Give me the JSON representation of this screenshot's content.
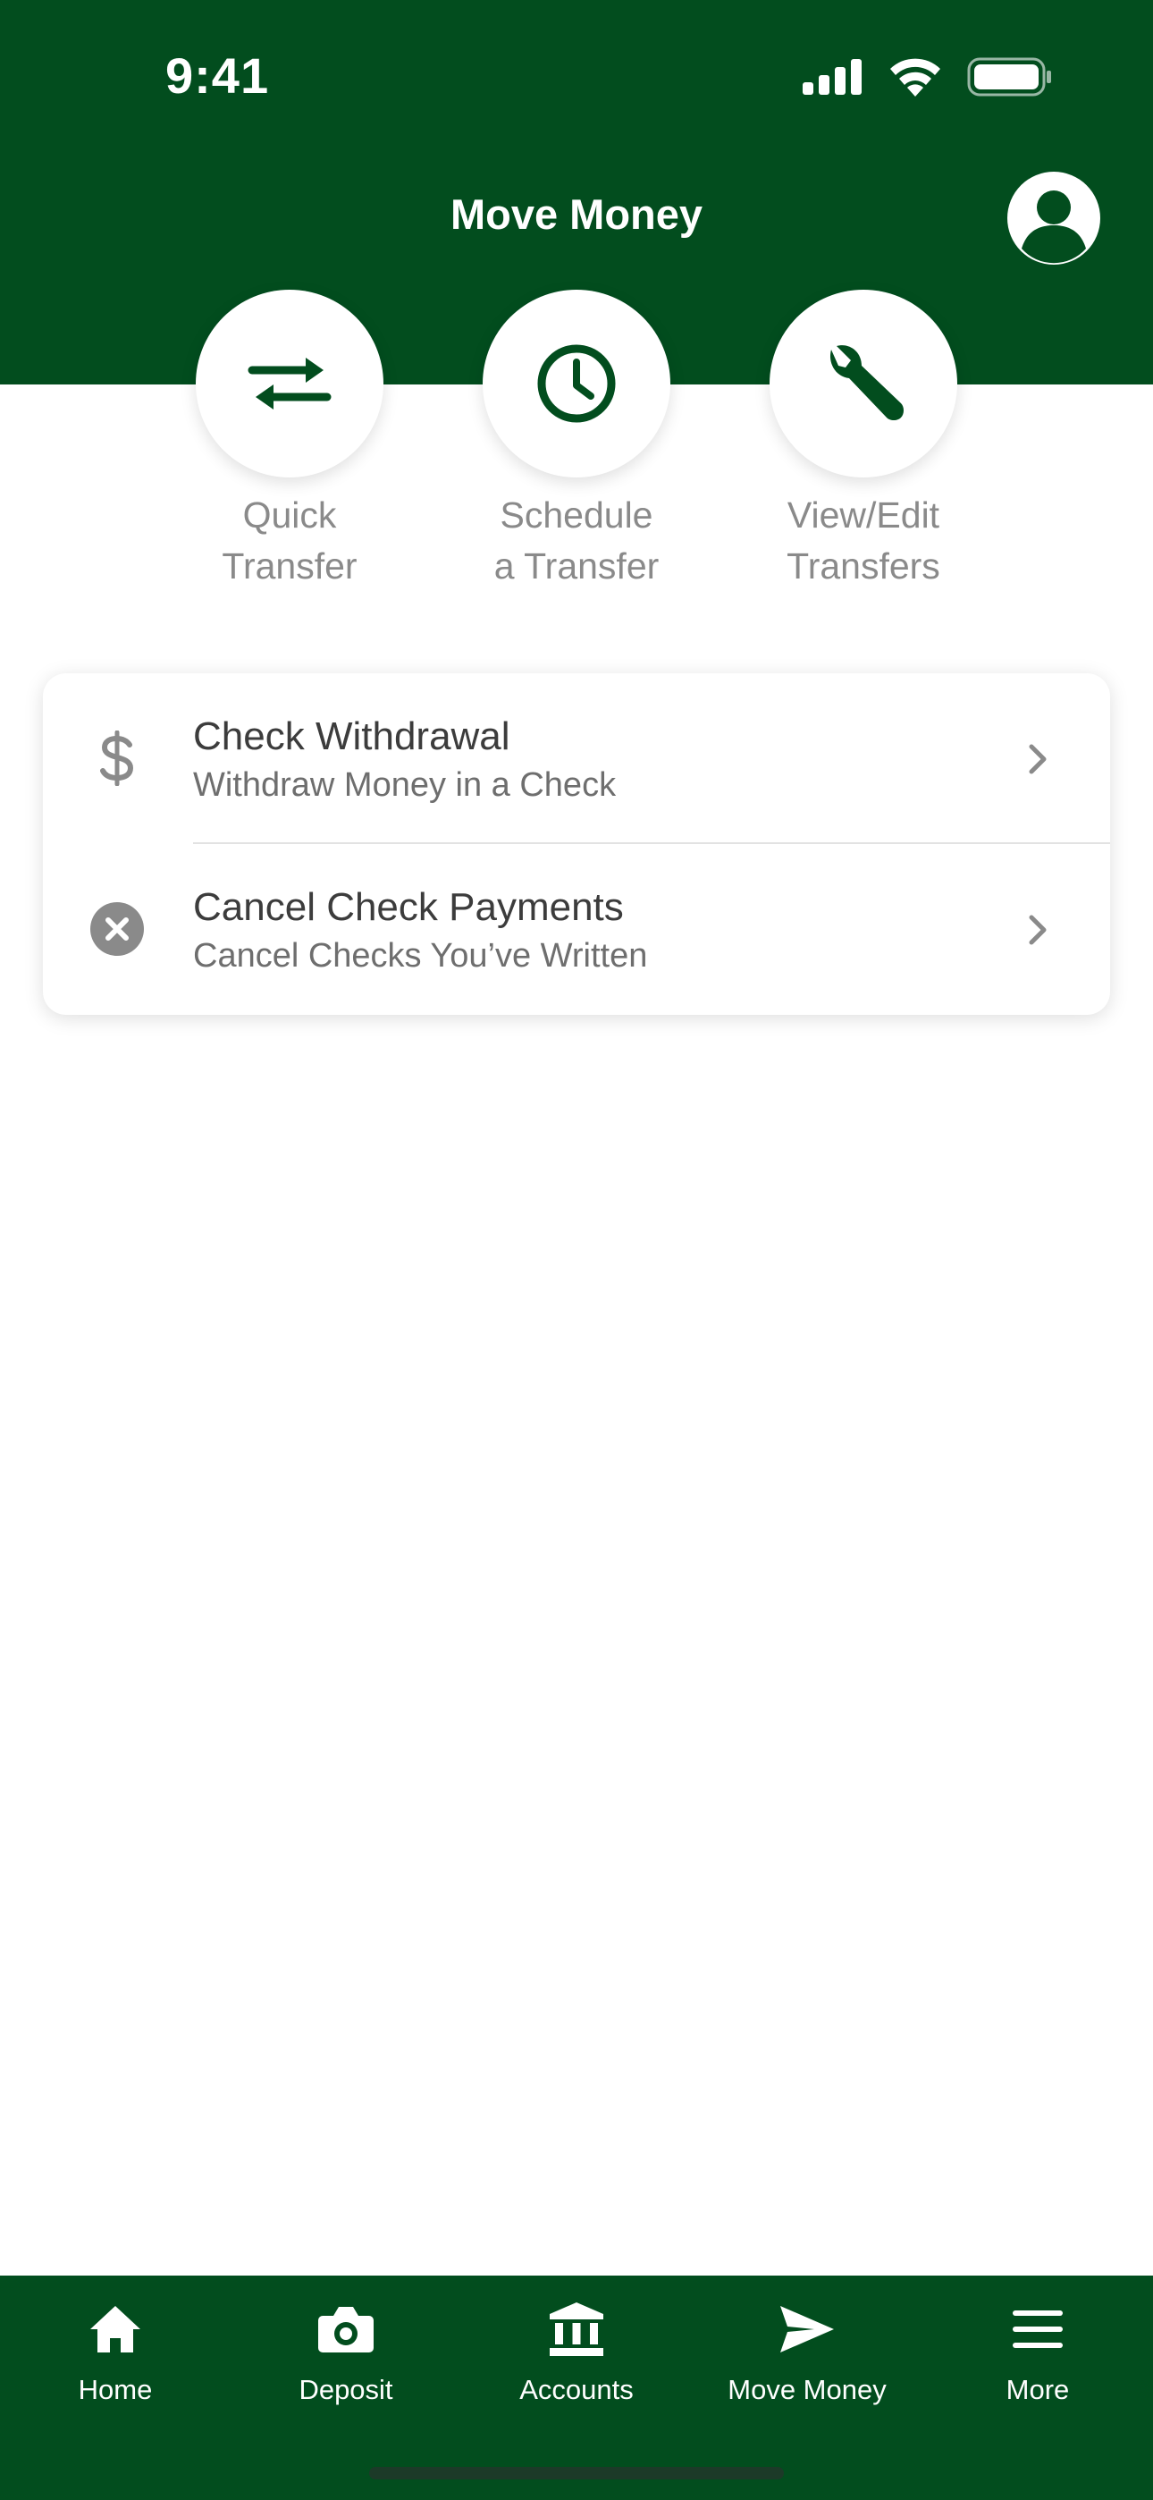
{
  "status_bar": {
    "time": "9:41"
  },
  "header": {
    "title": "Move Money"
  },
  "colors": {
    "brand_green": "#024d1e",
    "label_gray": "#8a8a8a",
    "text_dark": "#3c3c3c"
  },
  "quick_actions": [
    {
      "icon": "transfer-arrows-icon",
      "line1": "Quick",
      "line2": "Transfer"
    },
    {
      "icon": "clock-icon",
      "line1": "Schedule",
      "line2": "a Transfer"
    },
    {
      "icon": "wrench-icon",
      "line1": "View/Edit",
      "line2": "Transfers"
    }
  ],
  "menu": [
    {
      "icon": "dollar-icon",
      "title": "Check Withdrawal",
      "subtitle": "Withdraw Money in a Check"
    },
    {
      "icon": "cancel-circle-icon",
      "title": "Cancel Check Payments",
      "subtitle": "Cancel Checks You’ve Written"
    }
  ],
  "tabs": [
    {
      "icon": "home-icon",
      "label": "Home"
    },
    {
      "icon": "camera-icon",
      "label": "Deposit"
    },
    {
      "icon": "bank-icon",
      "label": "Accounts"
    },
    {
      "icon": "send-icon",
      "label": "Move Money",
      "selected": true
    },
    {
      "icon": "menu-icon",
      "label": "More"
    }
  ]
}
